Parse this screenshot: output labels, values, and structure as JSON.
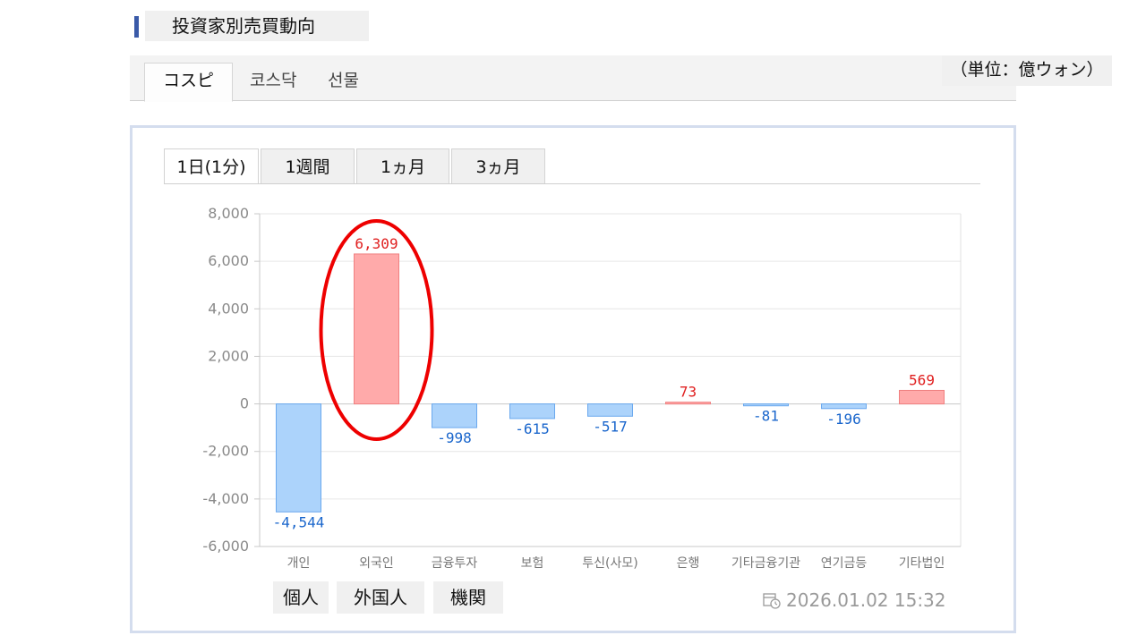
{
  "header": {
    "title": "投資家別売買動向"
  },
  "market_tabs": [
    {
      "label": "コスピ",
      "active": true
    },
    {
      "label": "코스닥",
      "active": false
    },
    {
      "label": "선물",
      "active": false
    }
  ],
  "unit_label": "（単位：億ウォン）",
  "period_tabs": [
    {
      "label": "1日(1分)",
      "active": true
    },
    {
      "label": "1週間",
      "active": false
    },
    {
      "label": "1ヵ月",
      "active": false
    },
    {
      "label": "3ヵ月",
      "active": false
    }
  ],
  "investor_labels": [
    "個人",
    "外国人",
    "機関"
  ],
  "timestamp": "2026.01.02 15:32",
  "colors": {
    "positive_fill": "#ffaaaa",
    "positive_stroke": "#f08080",
    "positive_text": "#e02020",
    "negative_fill": "#acd3fb",
    "negative_stroke": "#6aa8ee",
    "negative_text": "#1a66cc",
    "highlight": "#ee0000"
  },
  "chart_data": {
    "type": "bar",
    "categories": [
      "개인",
      "외국인",
      "금융투자",
      "보험",
      "투신(사모)",
      "은행",
      "기타금융기관",
      "연기금등",
      "기타법인"
    ],
    "values": [
      -4544,
      6309,
      -998,
      -615,
      -517,
      73,
      -81,
      -196,
      569
    ],
    "value_labels": [
      "-4,544",
      "6,309",
      "-998",
      "-615",
      "-517",
      "73",
      "-81",
      "-196",
      "569"
    ],
    "ylim": [
      -6000,
      8000
    ],
    "yticks": [
      "8,000",
      "6,000",
      "4,000",
      "2,000",
      "0",
      "-2,000",
      "-4,000",
      "-6,000"
    ],
    "ytick_values": [
      8000,
      6000,
      4000,
      2000,
      0,
      -2000,
      -4000,
      -6000
    ],
    "grid": true,
    "highlighted_category": "외국인"
  }
}
